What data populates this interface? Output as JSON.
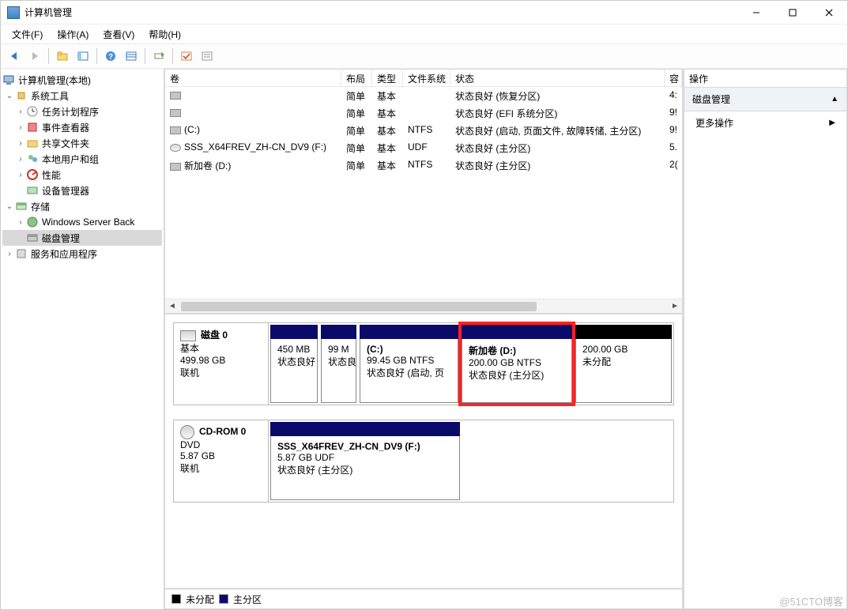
{
  "window": {
    "title": "计算机管理"
  },
  "menu": {
    "file": "文件(F)",
    "action": "操作(A)",
    "view": "查看(V)",
    "help": "帮助(H)"
  },
  "tree": {
    "root": "计算机管理(本地)",
    "system_tools": "系统工具",
    "task_scheduler": "任务计划程序",
    "event_viewer": "事件查看器",
    "shared_folders": "共享文件夹",
    "local_users": "本地用户和组",
    "performance": "性能",
    "device_manager": "设备管理器",
    "storage": "存储",
    "windows_server_backup": "Windows Server Back",
    "disk_management": "磁盘管理",
    "services_apps": "服务和应用程序"
  },
  "volume_table": {
    "headers": {
      "volume": "卷",
      "layout": "布局",
      "type": "类型",
      "fs": "文件系统",
      "status": "状态",
      "capacity": "容"
    },
    "rows": [
      {
        "vol": "",
        "layout": "简单",
        "type": "基本",
        "fs": "",
        "status": "状态良好 (恢复分区)",
        "cap": "4:"
      },
      {
        "vol": "",
        "layout": "简单",
        "type": "基本",
        "fs": "",
        "status": "状态良好 (EFI 系统分区)",
        "cap": "9!"
      },
      {
        "vol": "(C:)",
        "layout": "简单",
        "type": "基本",
        "fs": "NTFS",
        "status": "状态良好 (启动, 页面文件, 故障转储, 主分区)",
        "cap": "9!"
      },
      {
        "vol": "SSS_X64FREV_ZH-CN_DV9 (F:)",
        "layout": "简单",
        "type": "基本",
        "fs": "UDF",
        "status": "状态良好 (主分区)",
        "cap": "5.",
        "icon": "disk"
      },
      {
        "vol": "新加卷 (D:)",
        "layout": "简单",
        "type": "基本",
        "fs": "NTFS",
        "status": "状态良好 (主分区)",
        "cap": "2("
      }
    ]
  },
  "disk0": {
    "label": "磁盘 0",
    "type": "基本",
    "size": "499.98 GB",
    "status": "联机",
    "parts": [
      {
        "title": "",
        "size": "450 MB",
        "status": "状态良好"
      },
      {
        "title": "",
        "size": "99 M",
        "status": "状态良"
      },
      {
        "title": "(C:)",
        "size": "99.45 GB NTFS",
        "status": "状态良好 (启动, 页"
      },
      {
        "title": "新加卷  (D:)",
        "size": "200.00 GB NTFS",
        "status": "状态良好 (主分区)"
      },
      {
        "title": "",
        "size": "200.00 GB",
        "status": "未分配"
      }
    ]
  },
  "cdrom": {
    "label": "CD-ROM 0",
    "type": "DVD",
    "size": "5.87 GB",
    "status": "联机",
    "part": {
      "title": "SSS_X64FREV_ZH-CN_DV9 (F:)",
      "size": "5.87 GB UDF",
      "status": "状态良好 (主分区)"
    }
  },
  "legend": {
    "unalloc": "未分配",
    "primary": "主分区"
  },
  "actions": {
    "header": "操作",
    "section": "磁盘管理",
    "more": "更多操作"
  },
  "watermark": "@51CTO博客"
}
